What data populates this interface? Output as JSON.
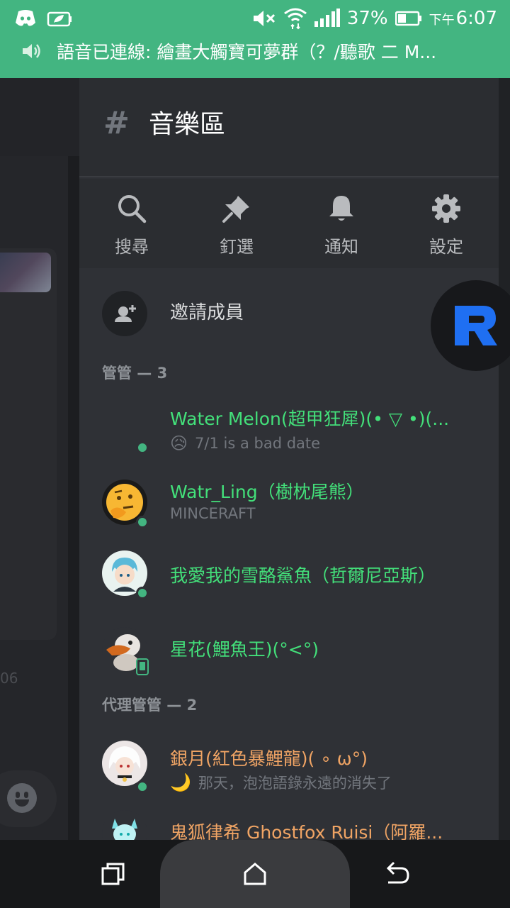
{
  "status_bar": {
    "battery_pct": "37%",
    "time_prefix": "下午",
    "time": "6:07",
    "voice_notice": "語音已連線: 繪畫大觸寶可夢群（？/聽歌 二 M..."
  },
  "background": {
    "timestamp_fragment": "06"
  },
  "channel": {
    "hash": "#",
    "title": "音樂區"
  },
  "actions": [
    {
      "label": "搜尋",
      "icon": "search-icon"
    },
    {
      "label": "釘選",
      "icon": "pin-icon"
    },
    {
      "label": "通知",
      "icon": "bell-icon"
    },
    {
      "label": "設定",
      "icon": "gear-icon"
    }
  ],
  "invite": {
    "label": "邀請成員"
  },
  "sections": {
    "admins": "管管 — 3",
    "deputies": "代理管管 — 2"
  },
  "members": [
    {
      "name": "Water Melon(超甲狂犀)(• ▽ •)(...",
      "activity": "7/1 is a bad date",
      "activity_emoji": "😥",
      "status": "online"
    },
    {
      "name": "Watr_Ling（樹枕尾熊）",
      "activity": "MINCERAFT",
      "status": "online"
    },
    {
      "name": "我愛我的雪酪鯊魚（哲爾尼亞斯）",
      "activity": "",
      "status": "online"
    },
    {
      "name": "星花(鯉魚王)(°<°)",
      "activity": "",
      "status": "mobile"
    },
    {
      "name": "銀月(紅色暴鯉龍)( ∘ ω°)",
      "activity": "那天，泡泡語錄永遠的消失了",
      "activity_emoji": "🌙",
      "status": "online"
    },
    {
      "name": "鬼狐律希 Ghostfox Ruisi（阿羅...",
      "activity": "",
      "status": "online"
    }
  ],
  "colors": {
    "status_bar": "#43b581",
    "drawer_bg": "#2f3136",
    "admin_name": "#43e07a",
    "deputy_name": "#f0a464",
    "online": "#43b581"
  }
}
